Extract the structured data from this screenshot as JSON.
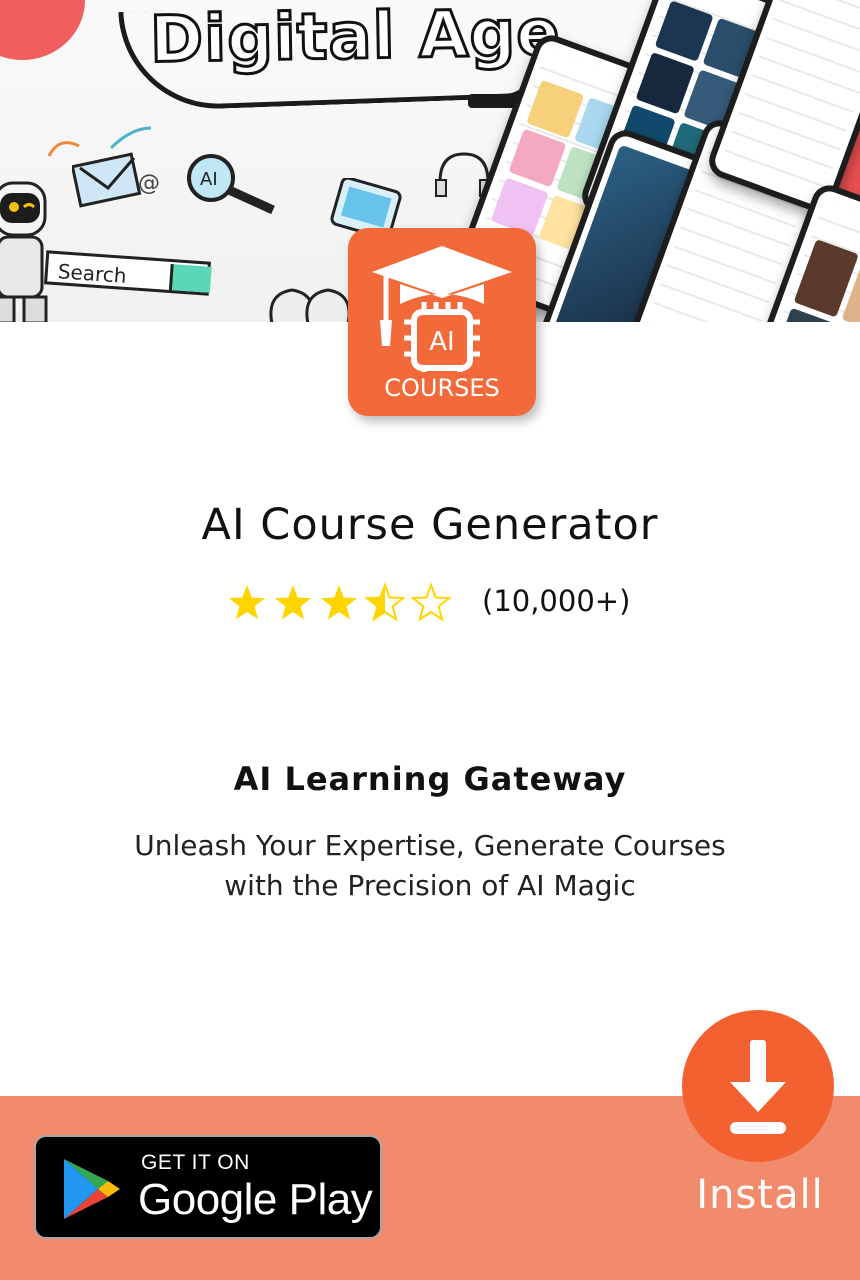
{
  "banner": {
    "headline": "Digital Age",
    "search_doodle_text": "Search"
  },
  "app": {
    "icon_label": "COURSES",
    "icon_chip_text": "AI",
    "title": "AI Course Generator",
    "rating_stars": 3.5,
    "rating_max": 5,
    "rating_count": "(10,000+)"
  },
  "promo": {
    "heading": "AI Learning Gateway",
    "description_line1": "Unleash Your Expertise, Generate Courses",
    "description_line2": "with the Precision of AI Magic"
  },
  "footer": {
    "badge_small": "GET IT ON",
    "badge_big": "Google Play",
    "install_label": "Install"
  },
  "colors": {
    "accent": "#f2693a",
    "footer_bg": "#f28b6b",
    "install_circle": "#f2612f",
    "star": "#ffd500"
  }
}
